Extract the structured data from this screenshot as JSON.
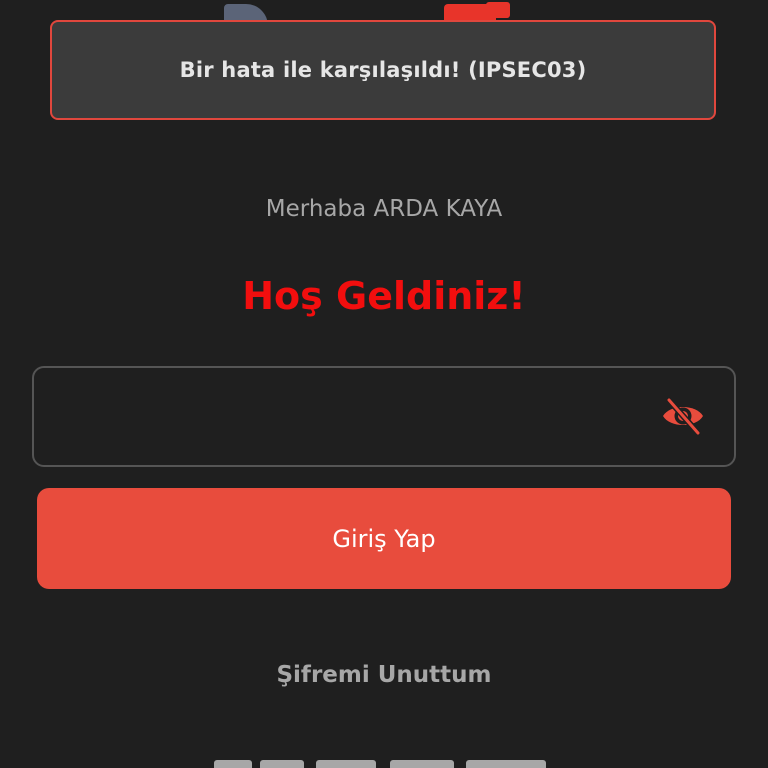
{
  "toast": {
    "message": "Bir hata ile karşılaşıldı! (IPSEC03)"
  },
  "login": {
    "greeting": "Merhaba ARDA KAYA",
    "welcome": "Hoş Geldiniz!",
    "password_value": "",
    "password_visibility_icon": "eye-off-icon",
    "submit_label": "Giriş Yap",
    "forgot_password_label": "Şifremi Unuttum"
  },
  "colors": {
    "background": "#1f1f1f",
    "accent": "#e84c3d",
    "welcome_text": "#f20e0e",
    "toast_border": "#e0473d"
  }
}
